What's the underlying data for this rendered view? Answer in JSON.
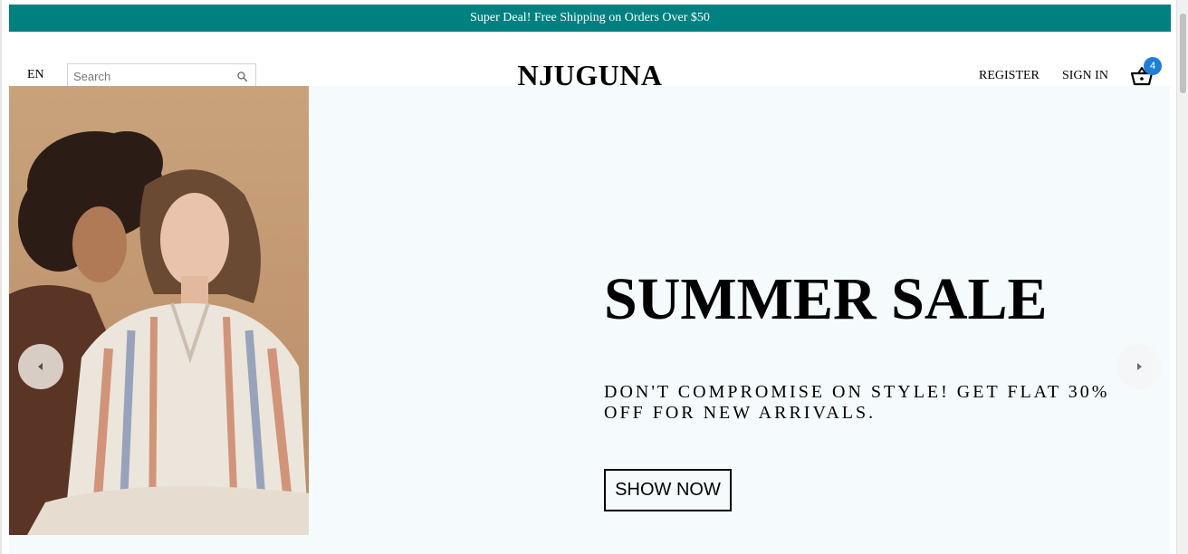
{
  "announcement": {
    "text": "Super Deal! Free Shipping on Orders Over $50"
  },
  "navbar": {
    "language": "EN",
    "search": {
      "placeholder": "Search",
      "value": ""
    },
    "logo": "NJUGUNA",
    "register_label": "REGISTER",
    "signin_label": "SIGN IN",
    "cart": {
      "icon": "basket-icon",
      "count": "4"
    }
  },
  "slider": {
    "slide": {
      "title": "SUMMER SALE",
      "description": "DON'T COMPROMISE ON STYLE! GET FLAT 30% OFF FOR NEW ARRIVALS.",
      "button_label": "SHOW NOW",
      "background_color": "#f5fafd"
    },
    "prev_icon": "arrow-left-icon",
    "next_icon": "arrow-right-icon"
  },
  "colors": {
    "announcement_bg": "#008080",
    "badge_bg": "#1e7fd6"
  }
}
